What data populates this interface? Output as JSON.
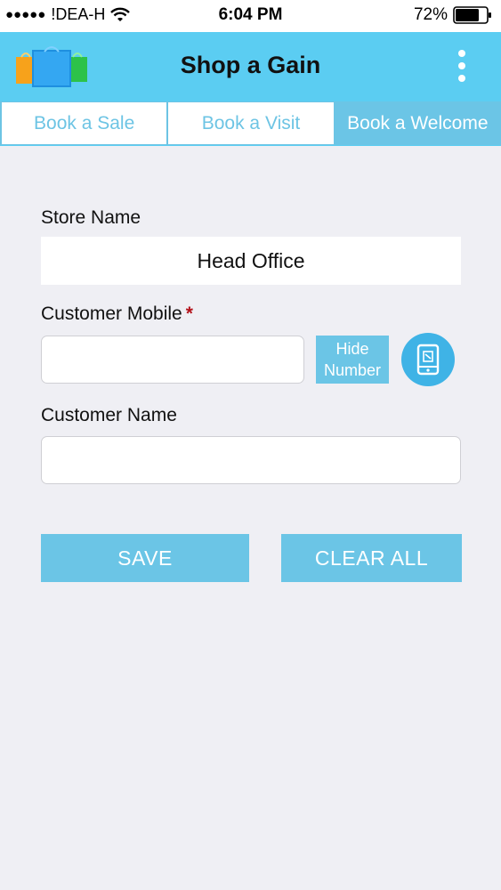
{
  "status_bar": {
    "signal": "●●●●●",
    "carrier": "!DEA-H",
    "time": "6:04 PM",
    "battery": "72%"
  },
  "header": {
    "title": "Shop a Gain"
  },
  "tabs": [
    {
      "label": "Book a Sale"
    },
    {
      "label": "Book a Visit"
    },
    {
      "label": "Book a Welcome"
    }
  ],
  "form": {
    "store_name_label": "Store Name",
    "store_name_value": "Head Office",
    "customer_mobile_label": "Customer Mobile",
    "required_mark": "*",
    "customer_mobile_value": "",
    "hide_number_label_1": "Hide",
    "hide_number_label_2": "Number",
    "customer_name_label": "Customer Name",
    "customer_name_value": ""
  },
  "actions": {
    "save_label": "SAVE",
    "clear_label": "CLEAR ALL"
  },
  "colors": {
    "header_bg": "#5bcdf2",
    "accent": "#6bc5e6",
    "required": "#b3121a"
  }
}
